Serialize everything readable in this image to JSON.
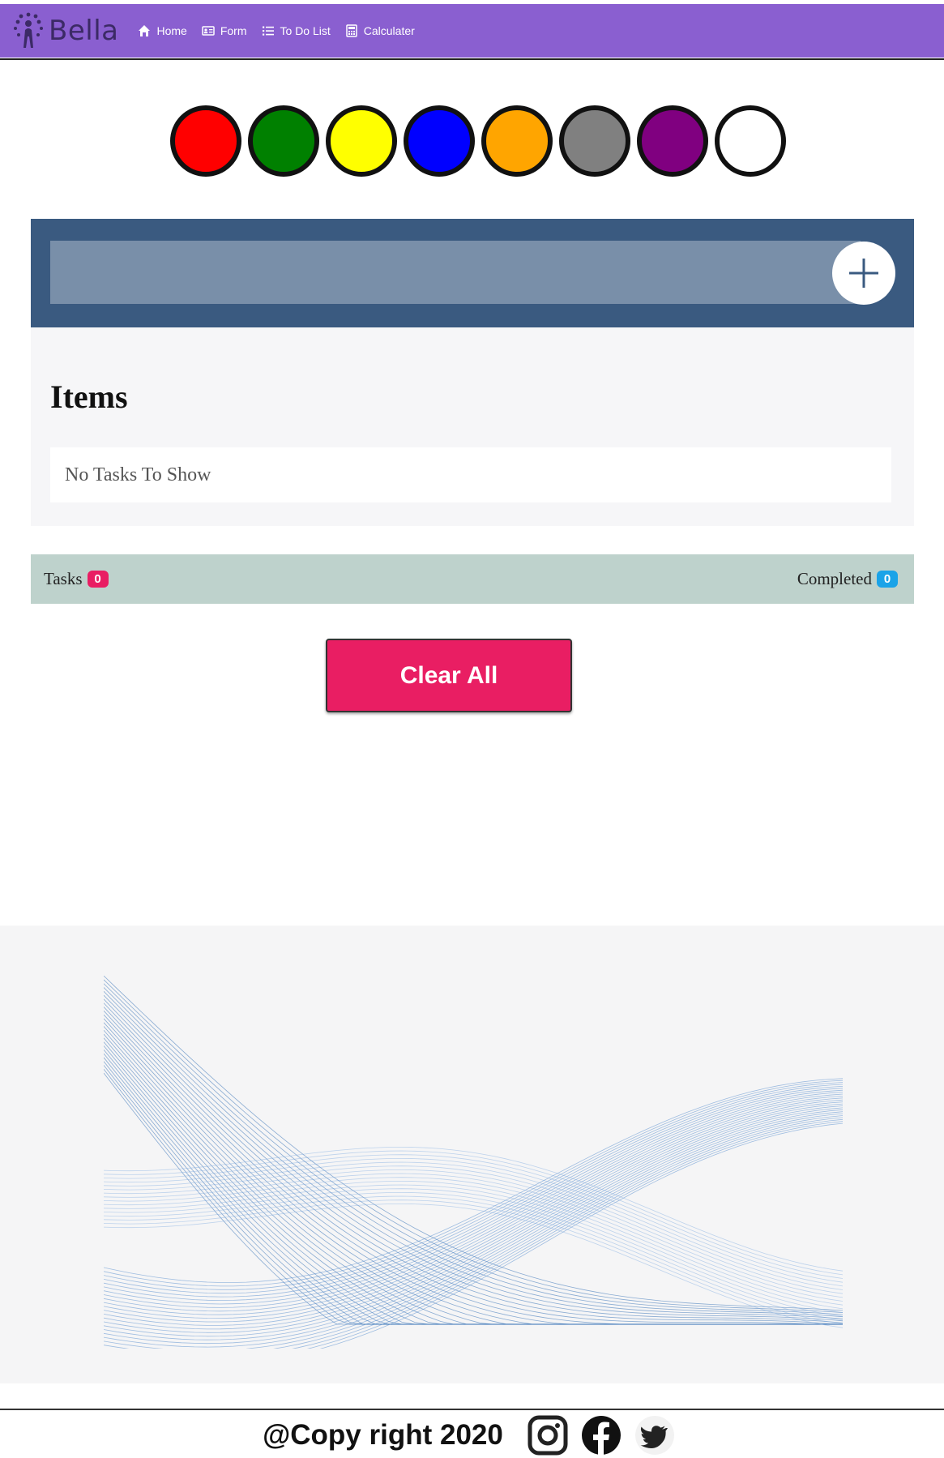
{
  "nav": {
    "brand": "Bella",
    "items": [
      {
        "label": "Home",
        "icon": "home-icon"
      },
      {
        "label": "Form",
        "icon": "id-card-icon"
      },
      {
        "label": "To Do List",
        "icon": "list-icon"
      },
      {
        "label": "Calculater",
        "icon": "calculator-icon"
      }
    ]
  },
  "colors": {
    "navbar": "#8a5fd0",
    "header": "#3a5a80",
    "status_bar": "#bed2cc",
    "accent": "#e91e63",
    "badge_blue": "#1aa3e8"
  },
  "swatches": [
    "#ff0000",
    "#008000",
    "#ffff00",
    "#0000ff",
    "#ffa500",
    "#808080",
    "#800080",
    "#ffffff"
  ],
  "todo": {
    "input_value": "",
    "input_placeholder": "",
    "items_title": "Items",
    "empty_message": "No Tasks To Show"
  },
  "status": {
    "tasks_label": "Tasks",
    "tasks_count": "0",
    "completed_label": "Completed",
    "completed_count": "0"
  },
  "clear_button": "Clear All",
  "footer": {
    "copyright": "@Copy right 2020",
    "social": [
      "instagram-icon",
      "facebook-icon",
      "twitter-icon"
    ]
  }
}
